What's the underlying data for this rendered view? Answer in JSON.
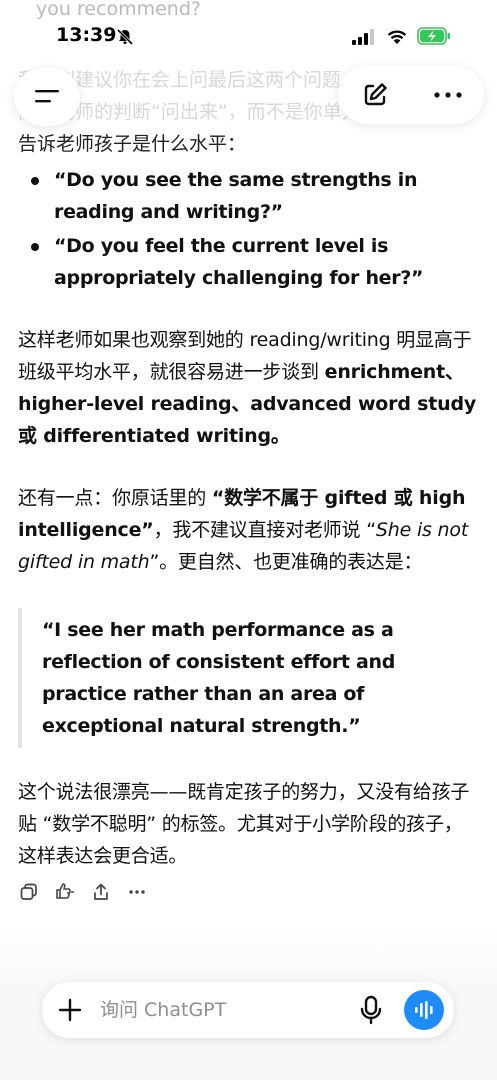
{
  "prev_message_tail": "you recommend?",
  "status_bar": {
    "time": "13:39"
  },
  "intro": {
    "line1": "我特别建议你在会上问最后这两个问题，因为它们",
    "line2": "能把老师的判断“问出来”，而不是你单方面",
    "line3": "告诉老师孩子是什么水平："
  },
  "bullets": [
    "“Do you see the same strengths in reading and writing?”",
    "“Do you feel the current level is appropriately challenging for her?”"
  ],
  "para1": {
    "text_a": "这样老师如果也观察到她的 reading/writing 明显高于班级平均水平，就很容易进一步谈到 ",
    "bold_b": "enrichment、higher-level reading、advanced word study 或 differentiated writing。"
  },
  "para2": {
    "text_a": "还有一点：你原话里的 ",
    "bold_b": "“数学不属于 gifted 或 high intelligence”",
    "text_c": "，我不建议直接对老师说 “",
    "italic_d": "She is not gifted in math",
    "text_e": "”。更自然、也更准确的表达是："
  },
  "quote": "“I see her math performance as a reflection of consistent effort and practice rather than an area of exceptional natural strength.”",
  "para3": "这个说法很漂亮——既肯定孩子的努力，又没有给孩子贴 “数学不聪明” 的标签。尤其对于小学阶段的孩子，这样表达会更合适。",
  "composer": {
    "placeholder": "询问 ChatGPT"
  },
  "icons": {
    "menu": "hamburger-icon",
    "new_chat": "compose-icon",
    "more": "ellipsis-icon",
    "copy": "copy-icon",
    "feedback": "thumbs-icon",
    "share": "share-icon",
    "plus": "plus-icon",
    "mic": "mic-icon",
    "voice": "voice-wave-icon"
  },
  "colors": {
    "accent": "#1d8cf8",
    "battery": "#34c759"
  }
}
